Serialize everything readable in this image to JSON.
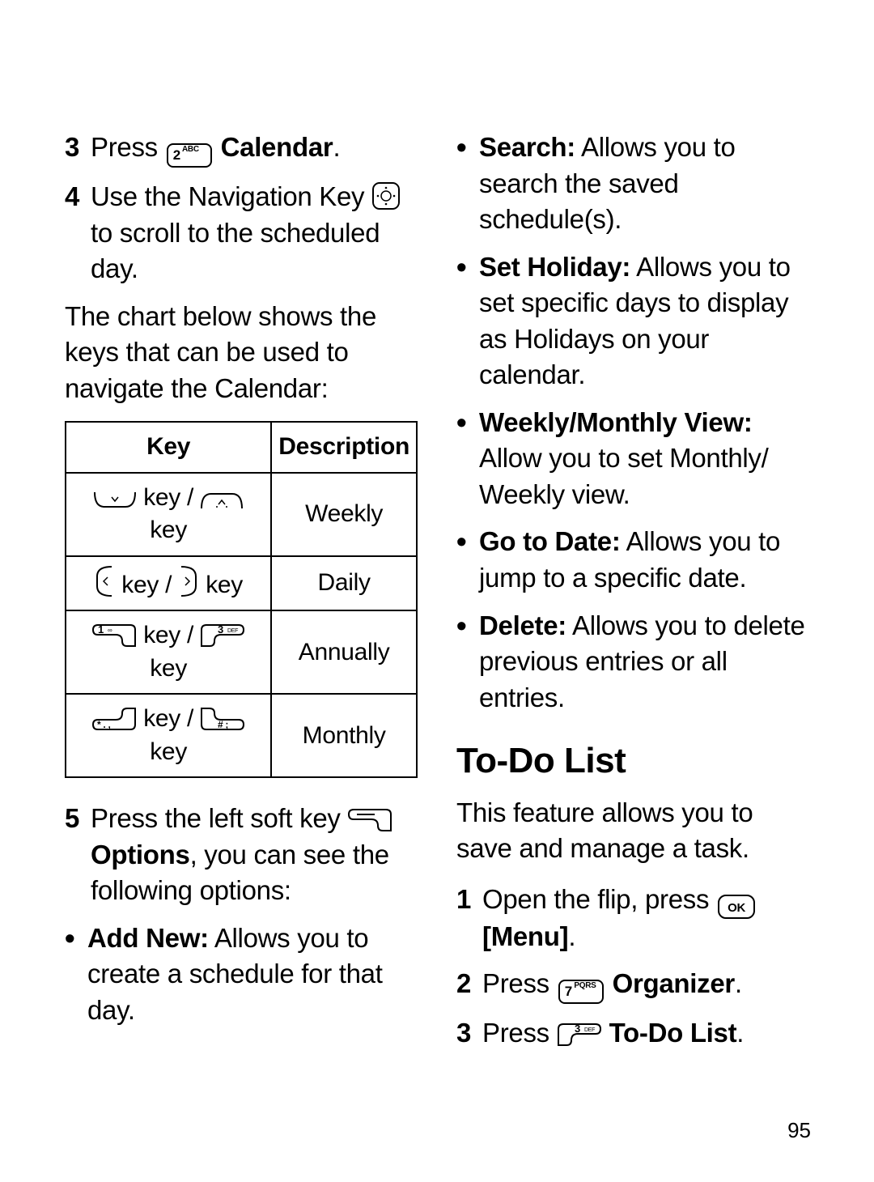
{
  "left": {
    "step3": {
      "num": "3",
      "press": "Press ",
      "key_label": "2 ABC",
      "after": " ",
      "bold": "Calendar",
      "end": "."
    },
    "step4": {
      "num": "4",
      "line1a": "Use the Navigation Key ",
      "line1b": " to scroll to the scheduled day."
    },
    "para1": "The chart below shows the keys that can be used to navigate the Calendar:",
    "table": {
      "h1": "Key",
      "h2": "Description",
      "rows": [
        {
          "keytext": " key / ",
          "keytext2": " key",
          "desc": "Weekly"
        },
        {
          "keytext": " key / ",
          "keytext2": " key",
          "desc": "Daily"
        },
        {
          "k1": "1 ∞",
          "keytext": " key / ",
          "k2": "3 DEF",
          "keytext2": " key",
          "desc": "Annually"
        },
        {
          "k1": "* . ,",
          "keytext": " key / ",
          "k2": "# ;",
          "keytext2": " key",
          "desc": "Monthly"
        }
      ]
    },
    "step5": {
      "num": "5",
      "a": "Press the left soft key ",
      "b": " ",
      "bold": "Options",
      "c": ", you can see the following options:"
    },
    "bullets": [
      {
        "bold": "Add New:",
        "rest": " Allows you to create a schedule for that day."
      }
    ]
  },
  "right": {
    "bullets": [
      {
        "bold": "Search:",
        "rest": " Allows you to search the saved schedule(s)."
      },
      {
        "bold": "Set Holiday:",
        "rest": " Allows you to set specific days to display as Holidays on your calendar."
      },
      {
        "bold": "Weekly/Monthly View:",
        "rest": " Allow you to set Monthly/ Weekly view."
      },
      {
        "bold": "Go to Date:",
        "rest": " Allows you to jump to a specific date."
      },
      {
        "bold": "Delete:",
        "rest": " Allows you to delete previous entries or all entries."
      }
    ],
    "heading": "To-Do List",
    "intro": "This feature allows you to save and manage a task.",
    "steps": [
      {
        "num": "1",
        "a": "Open the flip, press ",
        "key": "OK",
        "b": " ",
        "bold": "[Menu]",
        "c": "."
      },
      {
        "num": "2",
        "a": "Press ",
        "key": "7 PQRS",
        "b": " ",
        "bold": "Organizer",
        "c": "."
      },
      {
        "num": "3",
        "a": "Press ",
        "key": "3 DEF",
        "b": " ",
        "bold": "To-Do List",
        "c": "."
      }
    ]
  },
  "page_number": "95"
}
